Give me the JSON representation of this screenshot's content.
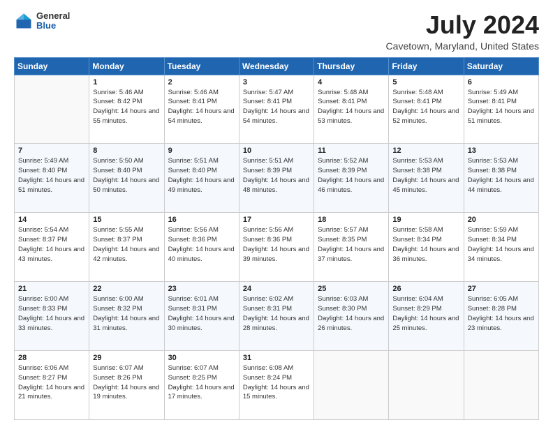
{
  "logo": {
    "general": "General",
    "blue": "Blue"
  },
  "title": "July 2024",
  "subtitle": "Cavetown, Maryland, United States",
  "headers": [
    "Sunday",
    "Monday",
    "Tuesday",
    "Wednesday",
    "Thursday",
    "Friday",
    "Saturday"
  ],
  "weeks": [
    [
      {
        "day": "",
        "sunrise": "",
        "sunset": "",
        "daylight": ""
      },
      {
        "day": "1",
        "sunrise": "Sunrise: 5:46 AM",
        "sunset": "Sunset: 8:42 PM",
        "daylight": "Daylight: 14 hours and 55 minutes."
      },
      {
        "day": "2",
        "sunrise": "Sunrise: 5:46 AM",
        "sunset": "Sunset: 8:41 PM",
        "daylight": "Daylight: 14 hours and 54 minutes."
      },
      {
        "day": "3",
        "sunrise": "Sunrise: 5:47 AM",
        "sunset": "Sunset: 8:41 PM",
        "daylight": "Daylight: 14 hours and 54 minutes."
      },
      {
        "day": "4",
        "sunrise": "Sunrise: 5:48 AM",
        "sunset": "Sunset: 8:41 PM",
        "daylight": "Daylight: 14 hours and 53 minutes."
      },
      {
        "day": "5",
        "sunrise": "Sunrise: 5:48 AM",
        "sunset": "Sunset: 8:41 PM",
        "daylight": "Daylight: 14 hours and 52 minutes."
      },
      {
        "day": "6",
        "sunrise": "Sunrise: 5:49 AM",
        "sunset": "Sunset: 8:41 PM",
        "daylight": "Daylight: 14 hours and 51 minutes."
      }
    ],
    [
      {
        "day": "7",
        "sunrise": "Sunrise: 5:49 AM",
        "sunset": "Sunset: 8:40 PM",
        "daylight": "Daylight: 14 hours and 51 minutes."
      },
      {
        "day": "8",
        "sunrise": "Sunrise: 5:50 AM",
        "sunset": "Sunset: 8:40 PM",
        "daylight": "Daylight: 14 hours and 50 minutes."
      },
      {
        "day": "9",
        "sunrise": "Sunrise: 5:51 AM",
        "sunset": "Sunset: 8:40 PM",
        "daylight": "Daylight: 14 hours and 49 minutes."
      },
      {
        "day": "10",
        "sunrise": "Sunrise: 5:51 AM",
        "sunset": "Sunset: 8:39 PM",
        "daylight": "Daylight: 14 hours and 48 minutes."
      },
      {
        "day": "11",
        "sunrise": "Sunrise: 5:52 AM",
        "sunset": "Sunset: 8:39 PM",
        "daylight": "Daylight: 14 hours and 46 minutes."
      },
      {
        "day": "12",
        "sunrise": "Sunrise: 5:53 AM",
        "sunset": "Sunset: 8:38 PM",
        "daylight": "Daylight: 14 hours and 45 minutes."
      },
      {
        "day": "13",
        "sunrise": "Sunrise: 5:53 AM",
        "sunset": "Sunset: 8:38 PM",
        "daylight": "Daylight: 14 hours and 44 minutes."
      }
    ],
    [
      {
        "day": "14",
        "sunrise": "Sunrise: 5:54 AM",
        "sunset": "Sunset: 8:37 PM",
        "daylight": "Daylight: 14 hours and 43 minutes."
      },
      {
        "day": "15",
        "sunrise": "Sunrise: 5:55 AM",
        "sunset": "Sunset: 8:37 PM",
        "daylight": "Daylight: 14 hours and 42 minutes."
      },
      {
        "day": "16",
        "sunrise": "Sunrise: 5:56 AM",
        "sunset": "Sunset: 8:36 PM",
        "daylight": "Daylight: 14 hours and 40 minutes."
      },
      {
        "day": "17",
        "sunrise": "Sunrise: 5:56 AM",
        "sunset": "Sunset: 8:36 PM",
        "daylight": "Daylight: 14 hours and 39 minutes."
      },
      {
        "day": "18",
        "sunrise": "Sunrise: 5:57 AM",
        "sunset": "Sunset: 8:35 PM",
        "daylight": "Daylight: 14 hours and 37 minutes."
      },
      {
        "day": "19",
        "sunrise": "Sunrise: 5:58 AM",
        "sunset": "Sunset: 8:34 PM",
        "daylight": "Daylight: 14 hours and 36 minutes."
      },
      {
        "day": "20",
        "sunrise": "Sunrise: 5:59 AM",
        "sunset": "Sunset: 8:34 PM",
        "daylight": "Daylight: 14 hours and 34 minutes."
      }
    ],
    [
      {
        "day": "21",
        "sunrise": "Sunrise: 6:00 AM",
        "sunset": "Sunset: 8:33 PM",
        "daylight": "Daylight: 14 hours and 33 minutes."
      },
      {
        "day": "22",
        "sunrise": "Sunrise: 6:00 AM",
        "sunset": "Sunset: 8:32 PM",
        "daylight": "Daylight: 14 hours and 31 minutes."
      },
      {
        "day": "23",
        "sunrise": "Sunrise: 6:01 AM",
        "sunset": "Sunset: 8:31 PM",
        "daylight": "Daylight: 14 hours and 30 minutes."
      },
      {
        "day": "24",
        "sunrise": "Sunrise: 6:02 AM",
        "sunset": "Sunset: 8:31 PM",
        "daylight": "Daylight: 14 hours and 28 minutes."
      },
      {
        "day": "25",
        "sunrise": "Sunrise: 6:03 AM",
        "sunset": "Sunset: 8:30 PM",
        "daylight": "Daylight: 14 hours and 26 minutes."
      },
      {
        "day": "26",
        "sunrise": "Sunrise: 6:04 AM",
        "sunset": "Sunset: 8:29 PM",
        "daylight": "Daylight: 14 hours and 25 minutes."
      },
      {
        "day": "27",
        "sunrise": "Sunrise: 6:05 AM",
        "sunset": "Sunset: 8:28 PM",
        "daylight": "Daylight: 14 hours and 23 minutes."
      }
    ],
    [
      {
        "day": "28",
        "sunrise": "Sunrise: 6:06 AM",
        "sunset": "Sunset: 8:27 PM",
        "daylight": "Daylight: 14 hours and 21 minutes."
      },
      {
        "day": "29",
        "sunrise": "Sunrise: 6:07 AM",
        "sunset": "Sunset: 8:26 PM",
        "daylight": "Daylight: 14 hours and 19 minutes."
      },
      {
        "day": "30",
        "sunrise": "Sunrise: 6:07 AM",
        "sunset": "Sunset: 8:25 PM",
        "daylight": "Daylight: 14 hours and 17 minutes."
      },
      {
        "day": "31",
        "sunrise": "Sunrise: 6:08 AM",
        "sunset": "Sunset: 8:24 PM",
        "daylight": "Daylight: 14 hours and 15 minutes."
      },
      {
        "day": "",
        "sunrise": "",
        "sunset": "",
        "daylight": ""
      },
      {
        "day": "",
        "sunrise": "",
        "sunset": "",
        "daylight": ""
      },
      {
        "day": "",
        "sunrise": "",
        "sunset": "",
        "daylight": ""
      }
    ]
  ]
}
